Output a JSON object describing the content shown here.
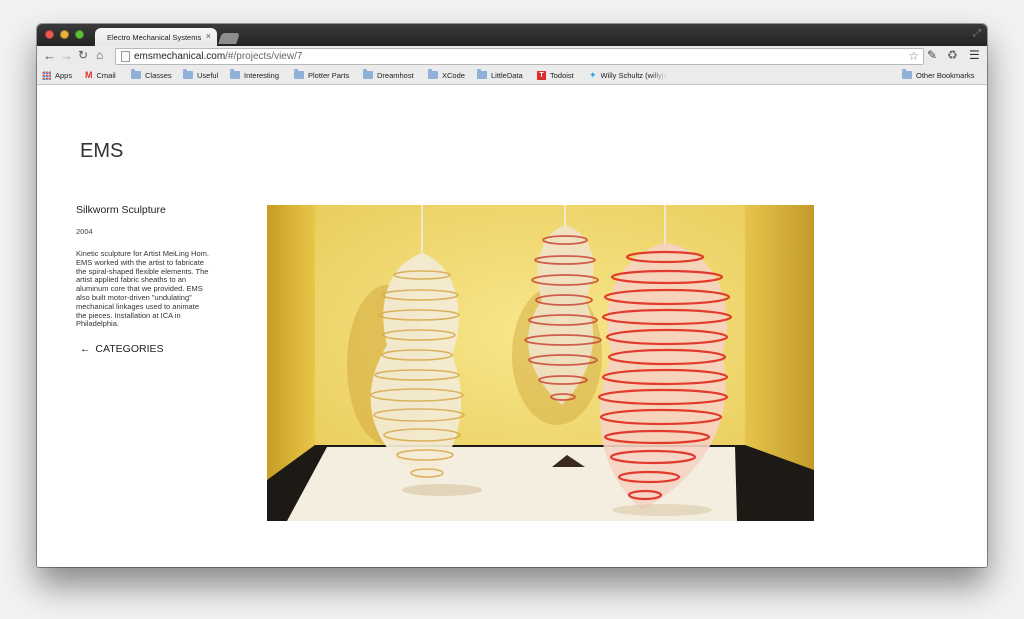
{
  "browser": {
    "tab_title": "Electro Mechanical Systems",
    "tab_close": "×",
    "url_host": "emsmechanical.com",
    "url_path": "/#/projects/view/7",
    "bookmarks": [
      {
        "label": "Apps",
        "icon": "apps-icon"
      },
      {
        "label": "Cmail",
        "icon": "gmail-icon"
      },
      {
        "label": "Classes",
        "icon": "folder-icon"
      },
      {
        "label": "Useful",
        "icon": "folder-icon"
      },
      {
        "label": "Interesting",
        "icon": "folder-icon"
      },
      {
        "label": "Plotter Parts",
        "icon": "folder-icon"
      },
      {
        "label": "Dreamhost",
        "icon": "folder-icon"
      },
      {
        "label": "XCode",
        "icon": "folder-icon"
      },
      {
        "label": "LittleData",
        "icon": "folder-icon"
      },
      {
        "label": "Todoist",
        "icon": "todoist-icon"
      },
      {
        "label": "Willy Schultz (willyjs",
        "icon": "twitter-icon"
      }
    ],
    "other_bookmarks": "Other Bookmarks"
  },
  "site": {
    "title": "EMS"
  },
  "project": {
    "title": "Silkworm Sculpture",
    "year": "2004",
    "description": "Kinetic sculpture for Artist MeiLing Hom. EMS worked with the artist to fabricate the spiral-shaped flexible elements. The artist applied fabric sheaths to an aluminum core that we provided. EMS also built motor-driven \"undulating\" mechanical linkages used to animate the pieces. Installation at ICA in Philadelphia.",
    "back_link": "CATEGORIES",
    "back_arrow": "←"
  },
  "colors": {
    "gallery_wall": "#efd56a",
    "floor": "#f4eee0",
    "sculpture_white": "#f3ecd6",
    "sculpture_red": "#e23a2c"
  }
}
